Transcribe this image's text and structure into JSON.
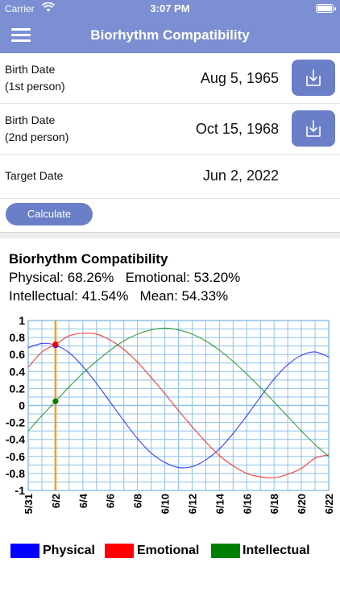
{
  "status_bar": {
    "carrier": "Carrier",
    "time": "3:07 PM"
  },
  "nav": {
    "title": "Biorhythm Compatibility"
  },
  "form": {
    "person1": {
      "label_line1": "Birth Date",
      "label_line2": "(1st person)",
      "value": "Aug 5, 1965"
    },
    "person2": {
      "label_line1": "Birth Date",
      "label_line2": "(2nd person)",
      "value": "Oct 15, 1968"
    },
    "target": {
      "label": "Target Date",
      "value": "Jun 2, 2022"
    },
    "calculate_label": "Calculate"
  },
  "results": {
    "title": "Biorhythm Compatibility",
    "line1": "Physical: 68.26%   Emotional: 53.20%",
    "line2": "Intellectual: 41.54%   Mean: 54.33%"
  },
  "icons": {
    "menu": "hamburger-menu-icon",
    "import": "download-tray-icon",
    "wifi": "wifi-icon",
    "battery": "battery-icon"
  },
  "colors": {
    "nav": "#7b8fd2",
    "button": "#6a7fc7",
    "grid": "#8fc2e6",
    "physical": "#0000ff",
    "emotional": "#ff0000",
    "intellectual": "#008000",
    "marker": "#f0a020"
  },
  "chart_data": {
    "type": "line",
    "x": [
      "5/31",
      "6/1",
      "6/2",
      "6/3",
      "6/4",
      "6/5",
      "6/6",
      "6/7",
      "6/8",
      "6/9",
      "6/10",
      "6/11",
      "6/12",
      "6/13",
      "6/14",
      "6/15",
      "6/16",
      "6/17",
      "6/18",
      "6/19",
      "6/20",
      "6/21",
      "6/22"
    ],
    "tick_labels": [
      "5/31",
      "6/2",
      "6/4",
      "6/6",
      "6/8",
      "6/10",
      "6/12",
      "6/14",
      "6/16",
      "6/18",
      "6/20",
      "6/22"
    ],
    "y_ticks": [
      "1",
      "0.8",
      "0.6",
      "0.4",
      "0.2",
      "0",
      "-0.2",
      "-0.4",
      "-0.6",
      "-0.8",
      "-1"
    ],
    "ylim": [
      -1,
      1
    ],
    "marker_x": "6/2",
    "series": [
      {
        "name": "Physical",
        "values": [
          0.68,
          0.73,
          0.71,
          0.62,
          0.46,
          0.26,
          0.04,
          -0.18,
          -0.39,
          -0.56,
          -0.67,
          -0.73,
          -0.72,
          -0.64,
          -0.51,
          -0.33,
          -0.12,
          0.1,
          0.31,
          0.48,
          0.59,
          0.63,
          0.57
        ]
      },
      {
        "name": "Emotional",
        "values": [
          0.45,
          0.63,
          0.72,
          0.82,
          0.85,
          0.84,
          0.77,
          0.66,
          0.51,
          0.33,
          0.14,
          -0.06,
          -0.25,
          -0.43,
          -0.59,
          -0.71,
          -0.8,
          -0.84,
          -0.85,
          -0.81,
          -0.74,
          -0.62,
          -0.58
        ]
      },
      {
        "name": "Intellectual",
        "values": [
          -0.3,
          -0.12,
          0.05,
          0.22,
          0.38,
          0.52,
          0.65,
          0.76,
          0.84,
          0.89,
          0.91,
          0.89,
          0.84,
          0.76,
          0.65,
          0.52,
          0.37,
          0.21,
          0.04,
          -0.13,
          -0.3,
          -0.46,
          -0.6
        ]
      }
    ],
    "legend_placement": "bottom",
    "grid": true
  }
}
